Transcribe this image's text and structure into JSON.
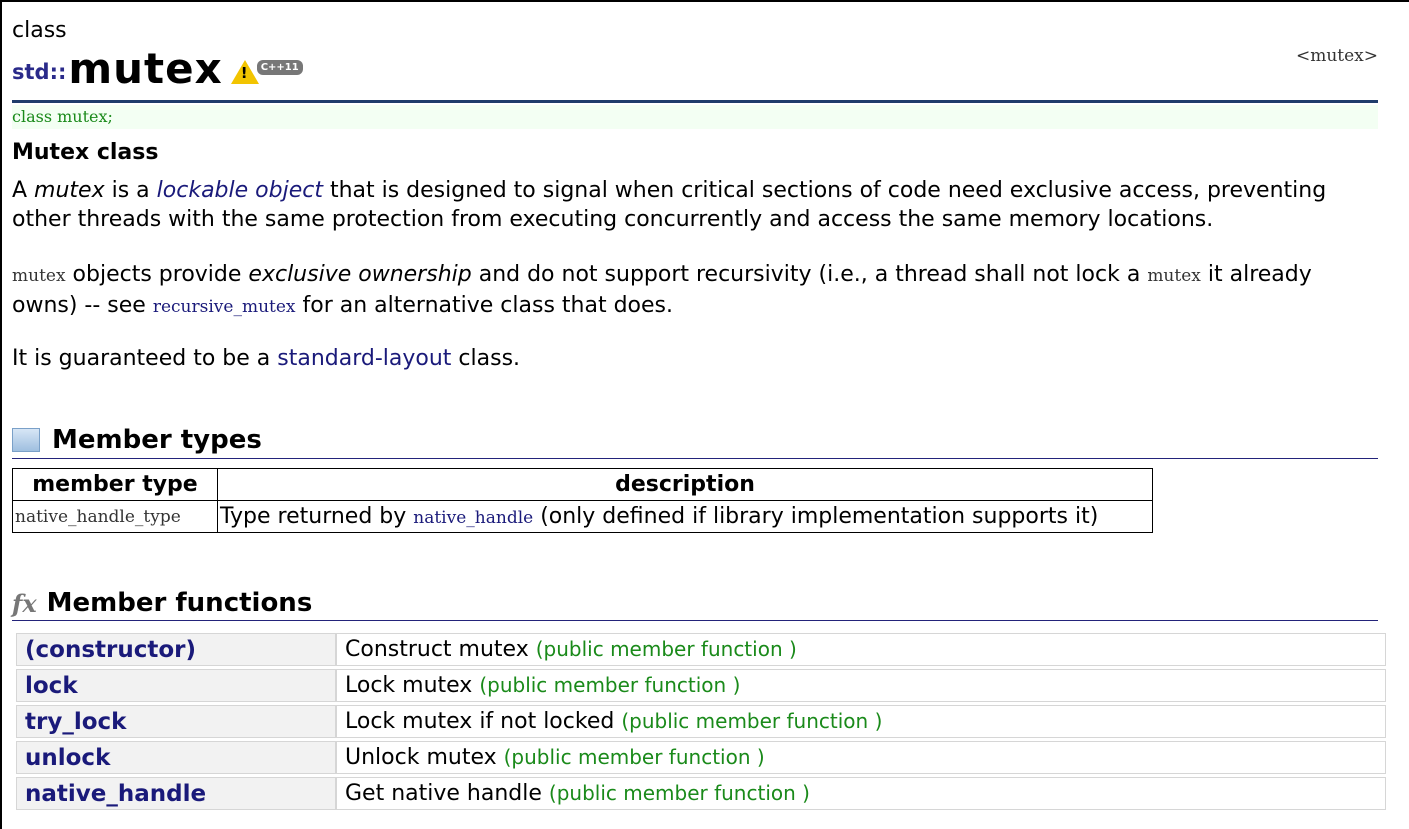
{
  "header": {
    "kind": "class",
    "namespace": "std::",
    "name": "mutex",
    "include": "<mutex>",
    "warning_glyph": "!",
    "cpp_badge": "C++11"
  },
  "declaration": "class mutex;",
  "subtitle": "Mutex class",
  "description": {
    "p1": {
      "a": "A ",
      "b": "mutex",
      "c": " is a ",
      "d": "lockable object",
      "e": " that is designed to signal when critical sections of code need exclusive access, preventing other threads with the same protection from executing concurrently and access the same memory locations."
    },
    "p2": {
      "a": "mutex",
      "b": " objects provide ",
      "c": "exclusive ownership",
      "d": " and do not support recursivity (i.e., a thread shall not lock a ",
      "e": "mutex",
      "f": " it already owns) -- see ",
      "g": "recursive_mutex",
      "h": " for an alternative class that does."
    },
    "p3": {
      "a": "It is guaranteed to be a ",
      "b": "standard-layout",
      "c": " class."
    }
  },
  "member_types": {
    "heading": "Member types",
    "columns": [
      "member type",
      "description"
    ],
    "rows": [
      {
        "type": "native_handle_type",
        "d1": "Type returned by ",
        "d2": "native_handle",
        "d3": " (only defined if library implementation supports it)"
      }
    ]
  },
  "member_functions": {
    "heading": "Member functions",
    "fx_glyph": "fx",
    "rows": [
      {
        "name": "(constructor)",
        "desc": "Construct mutex",
        "kind": "(public member function )"
      },
      {
        "name": "lock",
        "desc": "Lock mutex",
        "kind": "(public member function )"
      },
      {
        "name": "try_lock",
        "desc": "Lock mutex if not locked",
        "kind": "(public member function )"
      },
      {
        "name": "unlock",
        "desc": "Unlock mutex",
        "kind": "(public member function )"
      },
      {
        "name": "native_handle",
        "desc": "Get native handle",
        "kind": "(public member function )"
      }
    ]
  }
}
